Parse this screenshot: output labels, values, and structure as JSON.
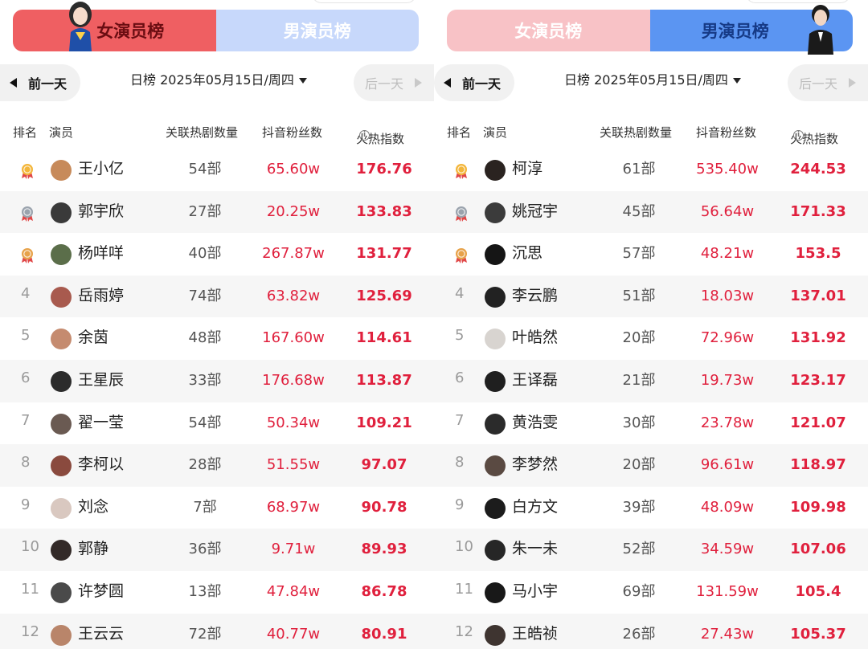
{
  "tabs": {
    "female": "女演员榜",
    "male": "男演员榜"
  },
  "nav": {
    "prev": "前一天",
    "next": "后一天",
    "date": "日榜 2025年05月15日/周四"
  },
  "columns": {
    "rank": "排名",
    "actor": "演员",
    "dramas": "关联热剧数量",
    "fans": "抖音粉丝数",
    "heat": "火热指数"
  },
  "colors": {
    "accent_red": "#e0203d",
    "female_tab": "#ef5f62",
    "male_tab": "#5b95f2",
    "gold": "#f3b63b",
    "silver": "#9aa3ad",
    "bronze": "#e7a24a"
  },
  "female": [
    {
      "rank": "1",
      "name": "王小亿",
      "dramas": "54部",
      "fans": "65.60w",
      "heat": "176.76",
      "medal": "gold",
      "avatar": "#c78a5a"
    },
    {
      "rank": "2",
      "name": "郭宇欣",
      "dramas": "27部",
      "fans": "20.25w",
      "heat": "133.83",
      "medal": "silver",
      "avatar": "#3a3a3a"
    },
    {
      "rank": "3",
      "name": "杨咩咩",
      "dramas": "40部",
      "fans": "267.87w",
      "heat": "131.77",
      "medal": "bronze",
      "avatar": "#5b6e4a"
    },
    {
      "rank": "4",
      "name": "岳雨婷",
      "dramas": "74部",
      "fans": "63.82w",
      "heat": "125.69",
      "medal": "",
      "avatar": "#a85a4e"
    },
    {
      "rank": "5",
      "name": "余茵",
      "dramas": "48部",
      "fans": "167.60w",
      "heat": "114.61",
      "medal": "",
      "avatar": "#c58b6f"
    },
    {
      "rank": "6",
      "name": "王星辰",
      "dramas": "33部",
      "fans": "176.68w",
      "heat": "113.87",
      "medal": "",
      "avatar": "#2c2c2c"
    },
    {
      "rank": "7",
      "name": "翟一莹",
      "dramas": "54部",
      "fans": "50.34w",
      "heat": "109.21",
      "medal": "",
      "avatar": "#6a5a52"
    },
    {
      "rank": "8",
      "name": "李柯以",
      "dramas": "28部",
      "fans": "51.55w",
      "heat": "97.07",
      "medal": "",
      "avatar": "#8a4a3e"
    },
    {
      "rank": "9",
      "name": "刘念",
      "dramas": "7部",
      "fans": "68.97w",
      "heat": "90.78",
      "medal": "",
      "avatar": "#d9c8c0"
    },
    {
      "rank": "10",
      "name": "郭静",
      "dramas": "36部",
      "fans": "9.71w",
      "heat": "89.93",
      "medal": "",
      "avatar": "#332a28"
    },
    {
      "rank": "11",
      "name": "许梦圆",
      "dramas": "13部",
      "fans": "47.84w",
      "heat": "86.78",
      "medal": "",
      "avatar": "#4a4a4a"
    },
    {
      "rank": "12",
      "name": "王云云",
      "dramas": "72部",
      "fans": "40.77w",
      "heat": "80.91",
      "medal": "",
      "avatar": "#b9856a"
    }
  ],
  "male": [
    {
      "rank": "1",
      "name": "柯淳",
      "dramas": "61部",
      "fans": "535.40w",
      "heat": "244.53",
      "medal": "gold",
      "avatar": "#2a2320"
    },
    {
      "rank": "2",
      "name": "姚冠宇",
      "dramas": "45部",
      "fans": "56.64w",
      "heat": "171.33",
      "medal": "silver",
      "avatar": "#3b3b3b"
    },
    {
      "rank": "3",
      "name": "沉思",
      "dramas": "57部",
      "fans": "48.21w",
      "heat": "153.5",
      "medal": "bronze",
      "avatar": "#151515"
    },
    {
      "rank": "4",
      "name": "李云鹏",
      "dramas": "51部",
      "fans": "18.03w",
      "heat": "137.01",
      "medal": "",
      "avatar": "#222222"
    },
    {
      "rank": "5",
      "name": "叶皓然",
      "dramas": "20部",
      "fans": "72.96w",
      "heat": "131.92",
      "medal": "",
      "avatar": "#d8d4d0"
    },
    {
      "rank": "6",
      "name": "王译磊",
      "dramas": "21部",
      "fans": "19.73w",
      "heat": "123.17",
      "medal": "",
      "avatar": "#1f1f1f"
    },
    {
      "rank": "7",
      "name": "黄浩雯",
      "dramas": "30部",
      "fans": "23.78w",
      "heat": "121.07",
      "medal": "",
      "avatar": "#2b2b2b"
    },
    {
      "rank": "8",
      "name": "李梦然",
      "dramas": "20部",
      "fans": "96.61w",
      "heat": "118.97",
      "medal": "",
      "avatar": "#5a4a42"
    },
    {
      "rank": "9",
      "name": "白方文",
      "dramas": "39部",
      "fans": "48.09w",
      "heat": "109.98",
      "medal": "",
      "avatar": "#1c1c1c"
    },
    {
      "rank": "10",
      "name": "朱一未",
      "dramas": "52部",
      "fans": "34.59w",
      "heat": "107.06",
      "medal": "",
      "avatar": "#262626"
    },
    {
      "rank": "11",
      "name": "马小宇",
      "dramas": "69部",
      "fans": "131.59w",
      "heat": "105.4",
      "medal": "",
      "avatar": "#181818"
    },
    {
      "rank": "12",
      "name": "王皓祯",
      "dramas": "26部",
      "fans": "27.43w",
      "heat": "105.37",
      "medal": "",
      "avatar": "#3e3430"
    }
  ]
}
